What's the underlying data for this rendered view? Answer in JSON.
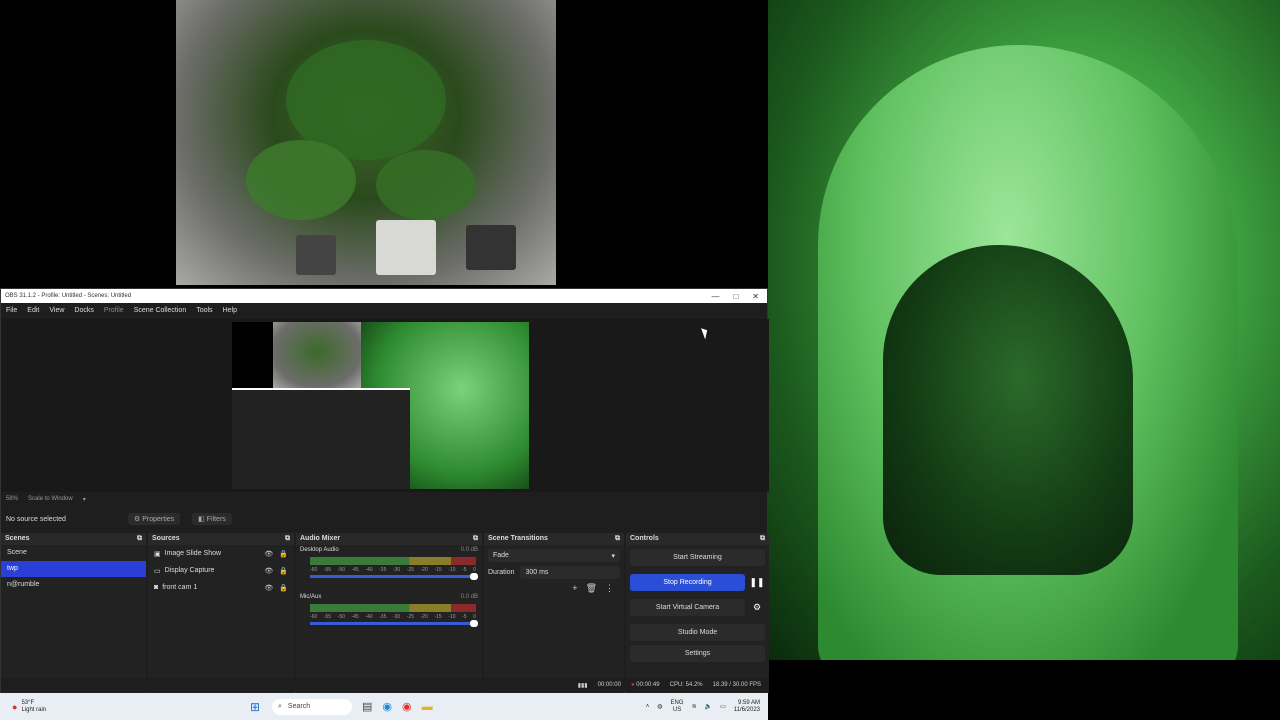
{
  "obs_window": {
    "title": "OBS 31.1.2 - Profile: Untitled - Scenes: Untitled",
    "window_buttons": [
      "—",
      "□",
      "✕"
    ],
    "menu": [
      "File",
      "Edit",
      "View",
      "Docks",
      "Profile",
      "Scene Collection",
      "Tools",
      "Help"
    ],
    "zoom": "58%",
    "scale_mode": "Scale to Window",
    "no_source": "No source selected",
    "properties_label": "Properties",
    "filters_label": "Filters"
  },
  "scenes": {
    "title": "Scenes",
    "items": [
      "Scene",
      "twp",
      "n@rumble"
    ],
    "selected_index": 1
  },
  "sources": {
    "title": "Sources",
    "items": [
      {
        "label": "Image Slide Show",
        "icon": "image-icon"
      },
      {
        "label": "Display Capture",
        "icon": "monitor-icon"
      },
      {
        "label": "front cam 1",
        "icon": "camera-icon"
      }
    ]
  },
  "audio_mixer": {
    "title": "Audio Mixer",
    "channels": [
      {
        "name": "Desktop Audio",
        "db": "0.0 dB"
      },
      {
        "name": "Mic/Aux",
        "db": "0.0 dB"
      }
    ],
    "scale": [
      "-60",
      "-55",
      "-50",
      "-45",
      "-40",
      "-35",
      "-30",
      "-25",
      "-20",
      "-15",
      "-10",
      "-5",
      "0"
    ]
  },
  "scene_transitions": {
    "title": "Scene Transitions",
    "transition": "Fade",
    "duration_label": "Duration",
    "duration_value": "300 ms"
  },
  "controls": {
    "title": "Controls",
    "start_streaming": "Start Streaming",
    "stop_recording": "Stop Recording",
    "start_virtual_camera": "Start Virtual Camera",
    "studio_mode": "Studio Mode",
    "settings": "Settings"
  },
  "status_bar": {
    "stream_time": "00:00:00",
    "rec_time": "00:00:49",
    "cpu": "CPU: 54.2%",
    "fps": "18.39 / 30.00 FPS"
  },
  "taskbar": {
    "weather_temp": "53°F",
    "weather_desc": "Light rain",
    "search_placeholder": "Search",
    "lang_top": "ENG",
    "lang_bottom": "US",
    "time": "9:59 AM",
    "date": "11/6/2023"
  },
  "colors": {
    "accent": "#2a4fd6",
    "obs_bg": "#1f1e1f",
    "record_red": "#e22222",
    "webcam_green": "#5fc05f"
  }
}
